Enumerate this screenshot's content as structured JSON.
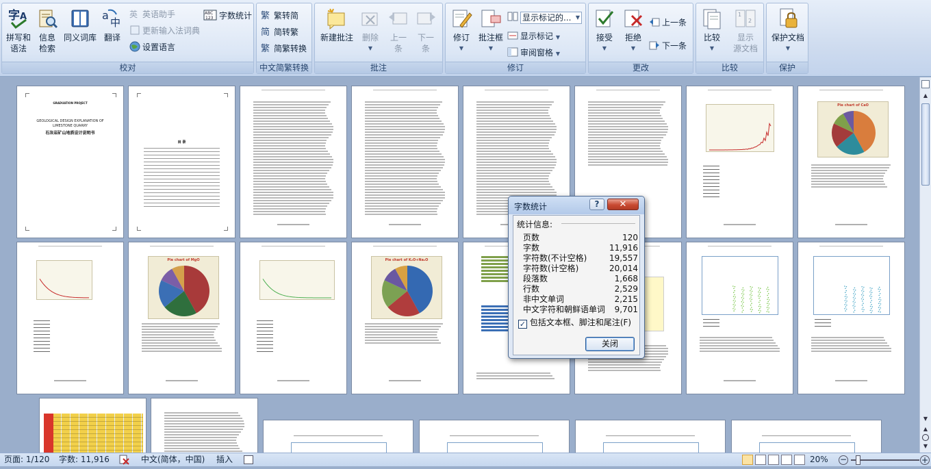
{
  "ribbon": {
    "proofing": {
      "group_label": "校对",
      "spelling_label_1": "拼写和",
      "spelling_label_2": "语法",
      "research_label_1": "信息",
      "research_label_2": "检索",
      "thesaurus_label": "同义词库",
      "translate_label": "翻译",
      "english_assistant": "英语助手",
      "update_ime": "更新输入法词典",
      "set_language": "设置语言",
      "word_count": "字数统计"
    },
    "chinese_conversion": {
      "group_label": "中文简繁转换",
      "to_traditional": "繁转简",
      "to_simplified": "简转繁",
      "conversion": "简繁转换"
    },
    "comments": {
      "group_label": "批注",
      "new_comment": "新建批注",
      "delete": "删除",
      "previous_1": "上一",
      "previous_2": "条",
      "next_1": "下一",
      "next_2": "条"
    },
    "tracking": {
      "group_label": "修订",
      "track_changes": "修订",
      "balloons": "批注框",
      "display_for_review": "显示标记的...",
      "show_markup": "显示标记",
      "reviewing_pane": "审阅窗格"
    },
    "changes": {
      "group_label": "更改",
      "accept": "接受",
      "reject": "拒绝",
      "previous": "上一条",
      "next": "下一条"
    },
    "compare": {
      "group_label": "比较",
      "compare": "比较",
      "show_source_1": "显示",
      "show_source_2": "源文档"
    },
    "protect": {
      "group_label": "保护",
      "protect_document": "保护文档"
    }
  },
  "thumbnails": {
    "cover_line1": "GRADUATION PROJECT",
    "cover_line2": "GEOLOGICAL DESIGN EXPLANATION OF",
    "cover_line3": "LIMESTONE QUARRY",
    "cover_line4": "石灰岩矿山地质设计说明书",
    "toc_title": "目    录",
    "chart_cao": "Pie chart of CaO",
    "chart_mgo": "Pie chart of MgO",
    "chart_k2o": "Pie chart of K₂O+Na₂O"
  },
  "dialog": {
    "title": "字数统计",
    "help": "?",
    "section_label": "统计信息:",
    "rows": [
      {
        "label": "页数",
        "value": "120"
      },
      {
        "label": "字数",
        "value": "11,916"
      },
      {
        "label": "字符数(不计空格)",
        "value": "19,557"
      },
      {
        "label": "字符数(计空格)",
        "value": "20,014"
      },
      {
        "label": "段落数",
        "value": "1,668"
      },
      {
        "label": "行数",
        "value": "2,529"
      },
      {
        "label": "非中文单词",
        "value": "2,215"
      },
      {
        "label": "中文字符和朝鲜语单词",
        "value": "9,701"
      }
    ],
    "checkbox_label": "包括文本框、脚注和尾注(F)",
    "checkbox_checked": true,
    "close_button": "关闭"
  },
  "status": {
    "page": "页面: 1/120",
    "words": "字数: 11,916",
    "language": "中文(简体，中国)",
    "mode": "插入",
    "zoom": "20%",
    "zoom_level": 0.2
  },
  "colors": {
    "accent": "#3d6aa8",
    "ribbon_bg": "#dbe6f5",
    "doc_bg": "#9aaecb",
    "pie_cao": [
      "#d97d3d",
      "#2e8c9c",
      "#a33b3b",
      "#7fa04a",
      "#6c5aa0"
    ],
    "pie_mgo": [
      "#a83a3a",
      "#2f6f3d",
      "#3b6fb5",
      "#7b5ea7",
      "#d4a04c"
    ],
    "pie_k2o": [
      "#3469b2",
      "#b03d3d",
      "#7ca153",
      "#6a58a1",
      "#d7a143"
    ]
  }
}
